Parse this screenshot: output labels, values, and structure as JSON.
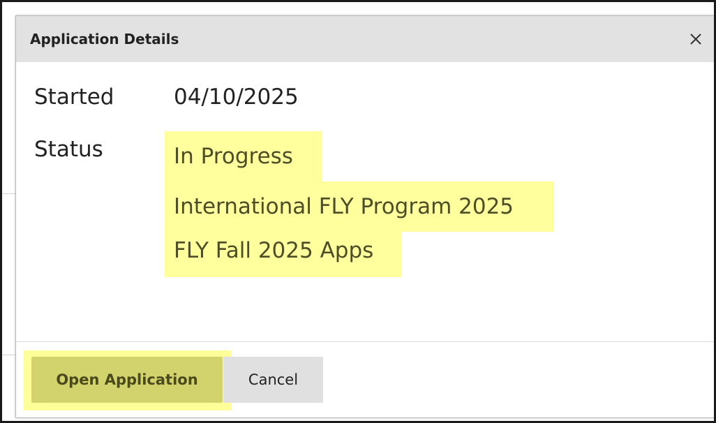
{
  "dialog": {
    "title": "Application Details",
    "close_icon": "close-icon",
    "fields": {
      "started_label": "Started",
      "started_value": "04/10/2025",
      "status_label": "Status",
      "status_values": [
        "In Progress",
        "International FLY Program 2025",
        "FLY Fall 2025 Apps"
      ]
    },
    "buttons": {
      "open_label": "Open Application",
      "cancel_label": "Cancel"
    }
  },
  "colors": {
    "highlight": "#ffff9e",
    "primary_button": "#d3d36e",
    "header_bg": "#e2e2e2",
    "background_heading": "#b3121f"
  }
}
